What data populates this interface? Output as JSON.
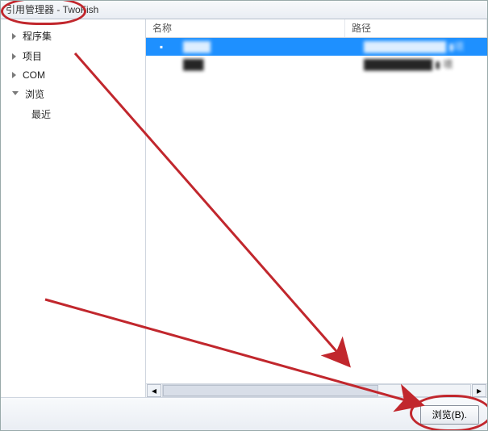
{
  "window": {
    "title": "引用管理器 - TwoFish"
  },
  "sidebar": {
    "items": [
      {
        "label": "程序集",
        "expanded": false
      },
      {
        "label": "项目",
        "expanded": false
      },
      {
        "label": "COM",
        "expanded": false
      },
      {
        "label": "浏览",
        "expanded": true,
        "children": [
          {
            "label": "最近"
          }
        ]
      }
    ]
  },
  "list": {
    "columns": {
      "name": "名称",
      "path": "路径"
    },
    "rows": [
      {
        "selected": true,
        "checkbox": "▪",
        "name": "████",
        "path": "████████████ ▮项"
      },
      {
        "selected": false,
        "checkbox": "",
        "name": "███",
        "path": "██████████ ▮ 项"
      }
    ]
  },
  "footer": {
    "browse_label": "浏览(B)."
  }
}
